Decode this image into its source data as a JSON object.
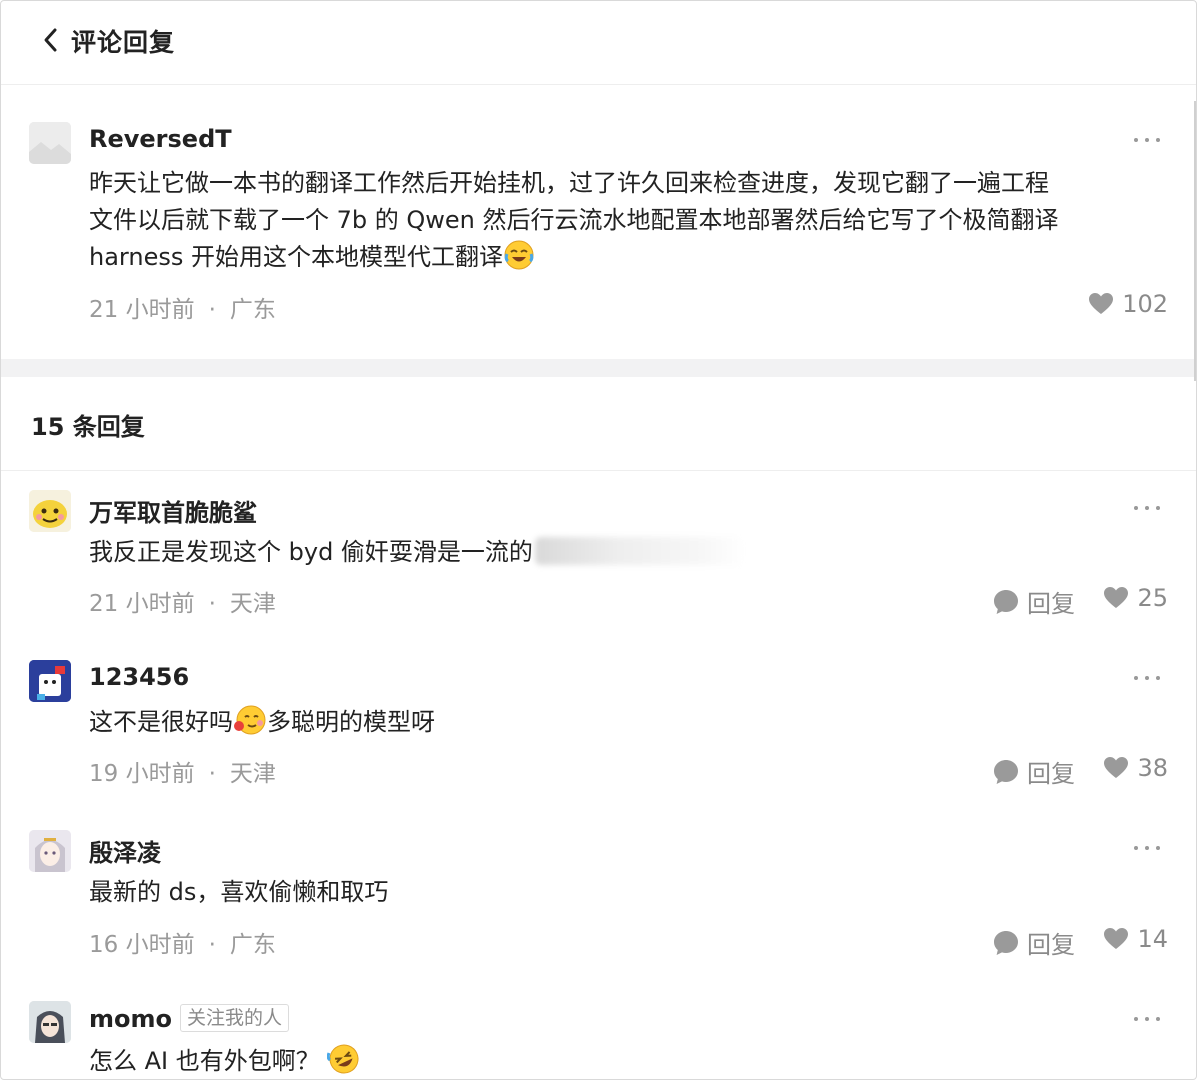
{
  "header": {
    "title": "评论回复"
  },
  "root": {
    "username": "ReversedT",
    "lines": [
      "昨天让它做一本书的翻译工作然后开始挂机，过了许久回来检查进度，发现它翻了一遍工程",
      "文件以后就下载了一个 7b 的 Qwen 然后行云流水地配置本地部署然后给它写了个极简翻译",
      "harness 开始用这个本地模型代工翻译"
    ],
    "time": "21 小时前",
    "location": "广东",
    "likes": "102"
  },
  "replies_header": "15 条回复",
  "replies": [
    {
      "username": "万军取首脆脆鲨",
      "text": "我反正是发现这个 byd 偷奸耍滑是一流的",
      "time": "21 小时前",
      "location": "天津",
      "reply_label": "回复",
      "likes": "25"
    },
    {
      "username": "123456",
      "text_before": "这不是很好吗",
      "text_after": "多聪明的模型呀",
      "time": "19 小时前",
      "location": "天津",
      "reply_label": "回复",
      "likes": "38"
    },
    {
      "username": "殷泽凌",
      "text": "最新的 ds，喜欢偷懒和取巧",
      "time": "16 小时前",
      "location": "广东",
      "reply_label": "回复",
      "likes": "14"
    },
    {
      "username": "momo",
      "tag": "关注我的人",
      "text": "怎么 AI 也有外包啊？",
      "time": "",
      "location": "",
      "reply_label": "",
      "likes": ""
    }
  ],
  "colors": {
    "muted": "#9a9a9a",
    "icon": "#8a8a8a",
    "divider": "#f2f2f3"
  }
}
